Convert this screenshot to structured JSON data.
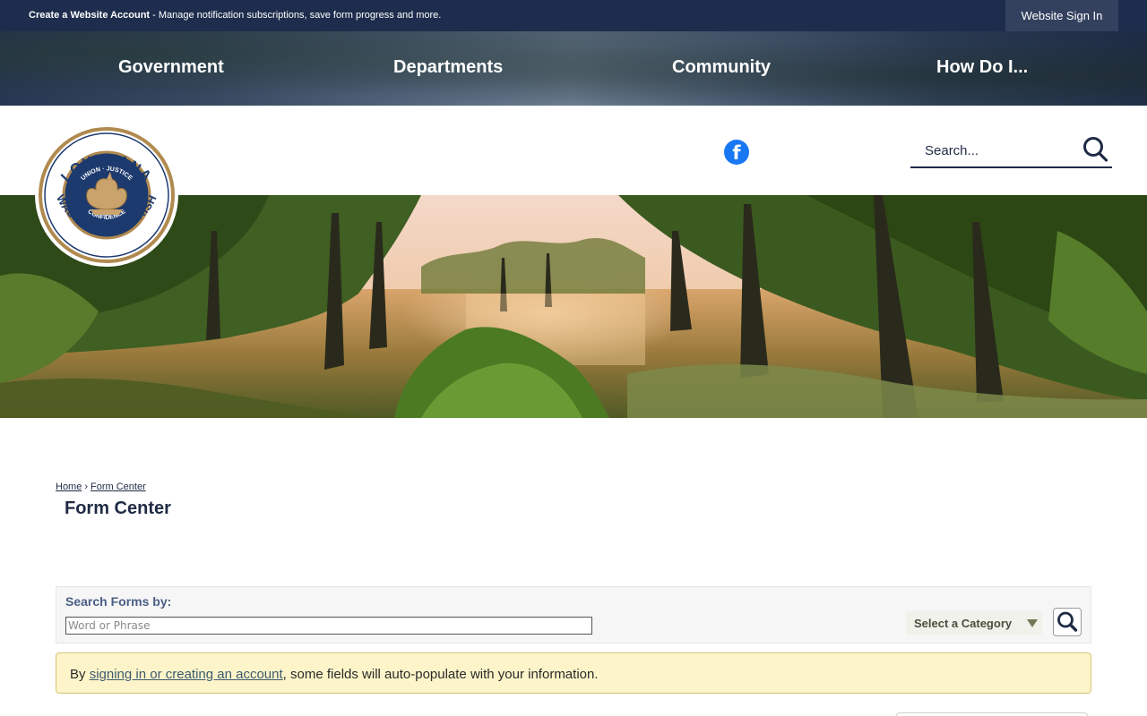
{
  "topbar": {
    "create_account_label": "Create a Website Account",
    "create_account_rest": " - Manage notification subscriptions, save form progress and more.",
    "sign_in_label": "Website Sign In"
  },
  "nav": {
    "items": [
      {
        "label": "Government"
      },
      {
        "label": "Departments"
      },
      {
        "label": "Community"
      },
      {
        "label": "How Do I..."
      }
    ]
  },
  "header": {
    "search_placeholder": "Search...",
    "social": "facebook-icon"
  },
  "seal": {
    "top_text": "LOUISIANA",
    "bottom_text": "WASHINGTON PARISH",
    "motto_top": "UNION · JUSTICE",
    "motto_bottom": "CONFIDENCE"
  },
  "breadcrumb": {
    "items": [
      {
        "label": "Home"
      },
      {
        "label": "Form Center"
      }
    ],
    "separator": "›"
  },
  "page": {
    "title": "Form Center"
  },
  "form_search": {
    "label": "Search Forms by:",
    "input_placeholder": "Word or Phrase",
    "category_label": "Select a Category"
  },
  "notice": {
    "prefix": "By ",
    "link_label": "signing in or creating an account",
    "suffix": ", some fields will auto-populate with your information."
  },
  "colors": {
    "topbar": "#1e2d4d",
    "text_dark": "#1f2a44",
    "facebook": "#1877f2",
    "notice_bg": "#fdf5c9",
    "seal_blue": "#1d3a6e",
    "seal_gold": "#b08a4f"
  }
}
